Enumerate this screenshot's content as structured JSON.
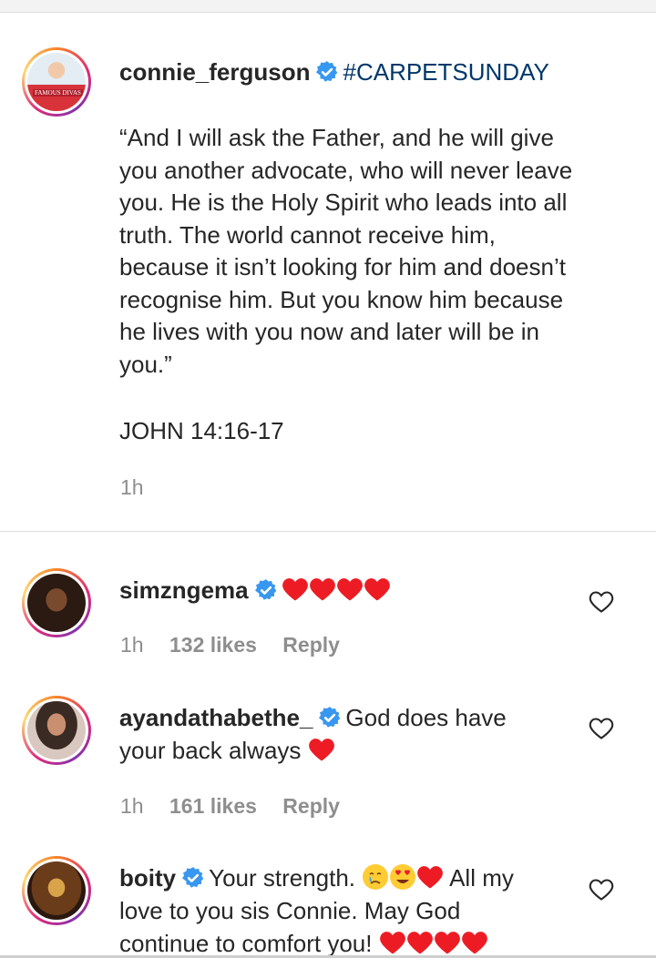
{
  "post": {
    "username": "connie_ferguson",
    "hashtag": "#CARPETSUNDAY",
    "avatar_text": "FAMOUS DIVAS",
    "body_lines": [
      "“And I will ask the Father, and he will give",
      "you another advocate, who will never leave",
      "you. He is the Holy Spirit who leads into all",
      "truth. The world cannot receive him,",
      "because it isn’t looking for him and doesn’t",
      "recognise him. But you know him because",
      "he lives with you now and later will be in",
      "you.”"
    ],
    "reference": "JOHN 14:16-17",
    "time": "1h"
  },
  "comments": [
    {
      "username": "simzngema",
      "time": "1h",
      "likes": "132 likes",
      "reply": "Reply"
    },
    {
      "username": "ayandathabethe_",
      "text_line1": "God does have",
      "text_line2": "your back always",
      "time": "1h",
      "likes": "161 likes",
      "reply": "Reply"
    },
    {
      "username": "boity",
      "text_line1": "Your strength.",
      "text_line1b": "All my",
      "text_line2": "love to you sis Connie. May God",
      "text_line3": "continue to comfort you!"
    }
  ],
  "colors": {
    "heart": "#ed1c24",
    "verified": "#3897f0",
    "hashtag": "#00376b",
    "meta": "#8e8e8e"
  },
  "icons": {
    "verified": "verified-badge-icon",
    "heart": "red-heart-icon",
    "like": "heart-outline-icon"
  }
}
